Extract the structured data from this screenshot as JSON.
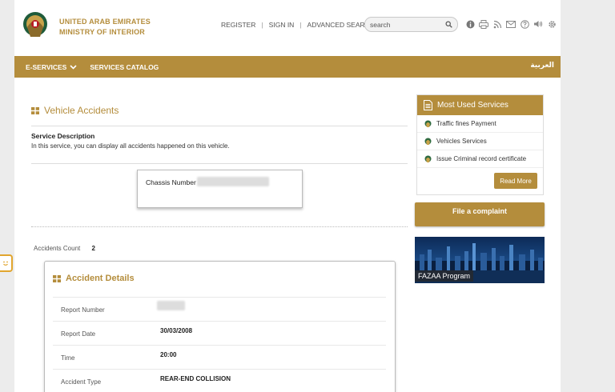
{
  "header": {
    "brand_line1": "UNITED ARAB EMIRATES",
    "brand_line2": "MINISTRY OF INTERIOR",
    "links": {
      "register": "REGISTER",
      "signin": "SIGN IN",
      "advanced": "ADVANCED SEARCH"
    },
    "search": {
      "value": "search"
    },
    "tool_icons": [
      "info-icon",
      "print-icon",
      "rss-icon",
      "mail-icon",
      "help-icon",
      "sound-icon",
      "settings-icon"
    ]
  },
  "nav": {
    "eservices": "E-SERVICES",
    "catalog": "SERVICES CATALOG",
    "arabic": "العربية"
  },
  "main": {
    "title": "Vehicle Accidents",
    "service_description_label": "Service Description",
    "service_description": "In this service, you can display all accidents happened on this vehicle.",
    "chassis_label": "Chassis Number",
    "accidents_count_label": "Accidents Count",
    "accidents_count": "2",
    "details": {
      "title": "Accident Details",
      "rows": [
        {
          "label": "Report Number",
          "value": ""
        },
        {
          "label": "Report Date",
          "value": "30/03/2008"
        },
        {
          "label": "Time",
          "value": "20:00"
        },
        {
          "label": "Accident Type",
          "value": "REAR-END COLLISION"
        }
      ]
    }
  },
  "sidebar": {
    "most_used_title": "Most Used Services",
    "items": [
      "Traffic fines Payment",
      "Vehicles Services",
      "Issue Criminal record certificate"
    ],
    "read_more": "Read More",
    "complaint": "File a complaint",
    "fazaa_caption": "FAZAA Program"
  },
  "colors": {
    "accent": "#b48d3c",
    "feedback_tab": "#e1a52e"
  }
}
